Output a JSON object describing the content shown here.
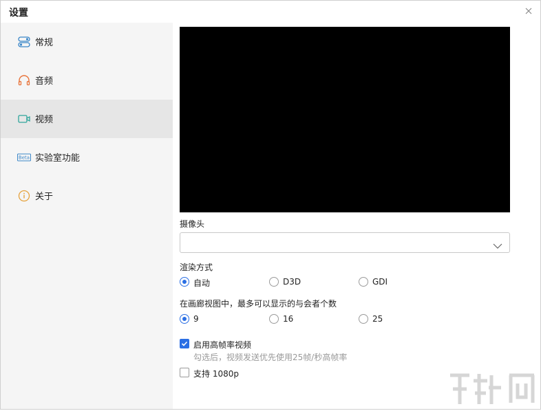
{
  "window": {
    "title": "设置"
  },
  "sidebar": {
    "items": [
      {
        "label": "常规",
        "icon": "toggle-icon"
      },
      {
        "label": "音频",
        "icon": "headphones-icon"
      },
      {
        "label": "视频",
        "icon": "camera-icon",
        "active": true
      },
      {
        "label": "实验室功能",
        "icon": "beta-icon",
        "badge": "Beta"
      },
      {
        "label": "关于",
        "icon": "info-icon"
      }
    ]
  },
  "video": {
    "camera": {
      "label": "摄像头",
      "value": ""
    },
    "render": {
      "label": "渲染方式",
      "options": [
        "自动",
        "D3D",
        "GDI"
      ],
      "selected": "自动"
    },
    "gallery": {
      "label": "在画廊视图中，最多可以显示的与会者个数",
      "options": [
        "9",
        "16",
        "25"
      ],
      "selected": "9"
    },
    "high_fps": {
      "label": "启用高帧率视频",
      "checked": true,
      "hint": "勾选后，视频发送优先使用25帧/秒高帧率"
    },
    "support_1080p": {
      "label": "支持 1080p",
      "checked": false
    }
  },
  "colors": {
    "accent": "#2b6fe4",
    "icon": "#3a86c8",
    "sidebar_bg": "#f5f5f5",
    "active_bg": "#e6e6e6"
  }
}
